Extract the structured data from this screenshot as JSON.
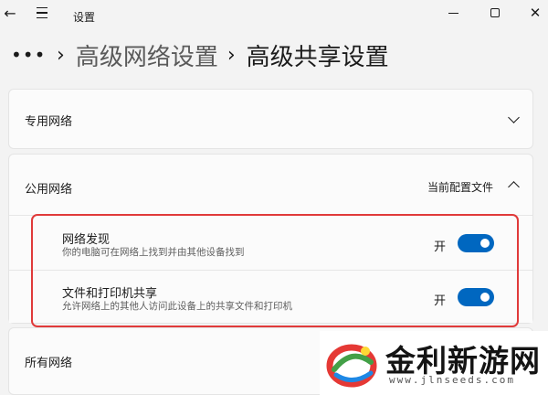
{
  "app": {
    "title": "设置"
  },
  "breadcrumb": {
    "more": "•••",
    "parent": "高级网络设置",
    "current": "高级共享设置"
  },
  "sections": {
    "private": {
      "label": "专用网络"
    },
    "public": {
      "label": "公用网络",
      "profile_note": "当前配置文件",
      "settings": [
        {
          "title": "网络发现",
          "description": "你的电脑可在网络上找到并由其他设备找到",
          "state": "开",
          "on": true
        },
        {
          "title": "文件和打印机共享",
          "description": "允许网络上的其他人访问此设备上的共享文件和打印机",
          "state": "开",
          "on": true
        }
      ]
    },
    "all": {
      "label": "所有网络"
    }
  },
  "logo": {
    "name": "金利新游网",
    "url": "www.jlnseeds.com"
  },
  "colors": {
    "accent": "#0067c0",
    "highlight": "#e03a3a"
  },
  "icons": [
    "back-arrow-icon",
    "menu-icon",
    "minimize-icon",
    "maximize-icon",
    "close-icon",
    "chevron-down-icon",
    "chevron-up-icon"
  ]
}
